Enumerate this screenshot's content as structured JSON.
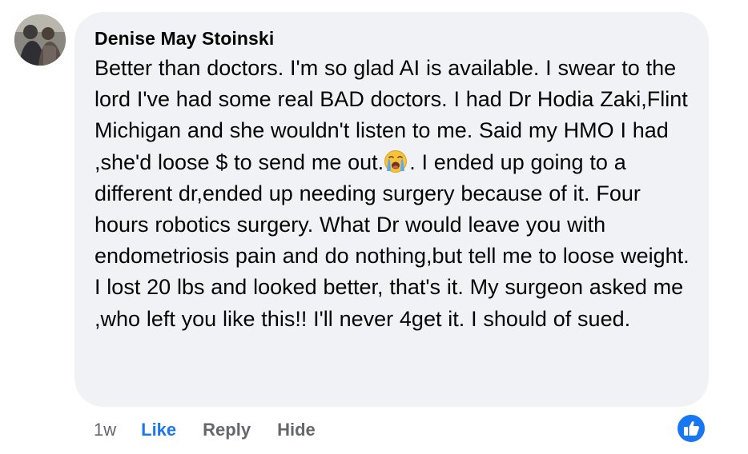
{
  "comment": {
    "author": "Denise May Stoinski",
    "text_before_emoji": "Better than doctors. I'm so glad AI is available. I swear to the lord I've had some real BAD doctors. I had Dr Hodia Zaki,Flint Michigan and she wouldn't listen to me. Said my HMO I had ,she'd loose $ to send me out.",
    "emoji": "loudly-crying-face",
    "text_after_emoji": ". I ended up going to a different dr,ended up needing surgery because of it. Four hours robotics surgery. What Dr would leave you with endometriosis pain and do nothing,but tell me to loose weight. I lost 20 lbs and looked better, that's it. My surgeon asked me ,who left you like this!! I'll never 4get it. I should of sued."
  },
  "actions": {
    "time": "1w",
    "like": "Like",
    "reply": "Reply",
    "hide": "Hide"
  },
  "reaction": {
    "icon": "thumbs-up-icon",
    "color": "#1877f2"
  },
  "colors": {
    "bubble": "#f0f2f5",
    "text": "#050505",
    "secondary": "#65676b",
    "accent": "#1877f2"
  }
}
